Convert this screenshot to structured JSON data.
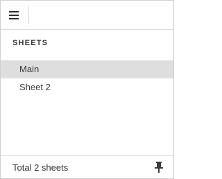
{
  "header": {
    "menu_icon": "hamburger-menu-icon"
  },
  "sheets_panel": {
    "title": "SHEETS",
    "items": [
      {
        "label": "Main",
        "selected": true
      },
      {
        "label": "Sheet 2",
        "selected": false
      }
    ]
  },
  "footer": {
    "total_label": "Total 2 sheets",
    "pin_icon": "pin-icon"
  },
  "colors": {
    "selected_row_bg": "#dedede",
    "border": "#cfcfcf",
    "text": "#333333"
  }
}
